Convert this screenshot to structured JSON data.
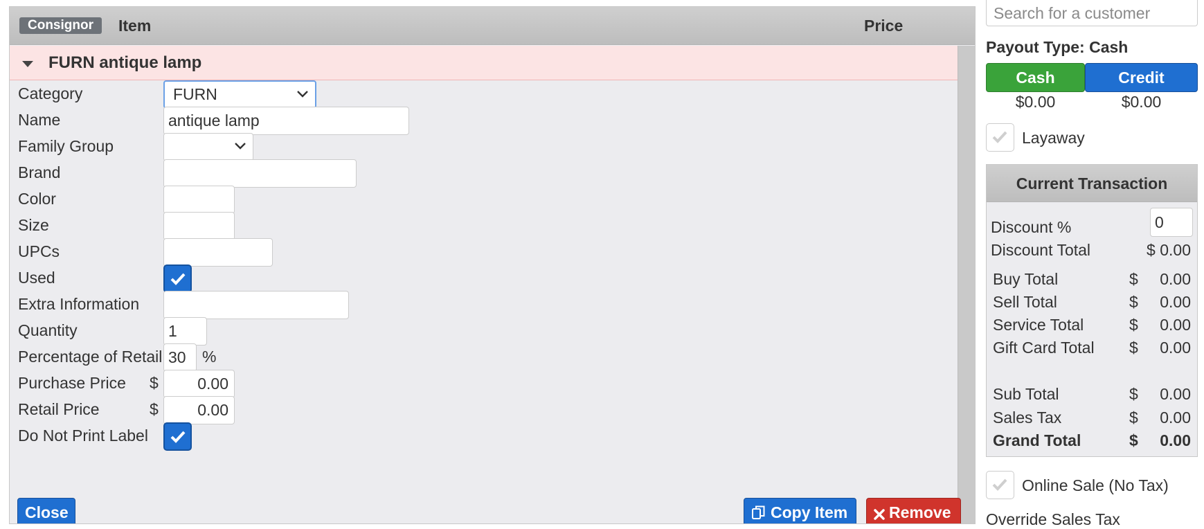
{
  "item_panel": {
    "header": {
      "consignor_badge": "Consignor",
      "item_label": "Item",
      "price_label": "Price"
    },
    "item_title": "FURN antique lamp",
    "fields": {
      "category": {
        "label": "Category",
        "value": "FURN"
      },
      "name": {
        "label": "Name",
        "value": "antique lamp"
      },
      "family_group": {
        "label": "Family Group",
        "value": ""
      },
      "brand": {
        "label": "Brand",
        "value": ""
      },
      "color": {
        "label": "Color",
        "value": ""
      },
      "size": {
        "label": "Size",
        "value": ""
      },
      "upcs": {
        "label": "UPCs",
        "value": ""
      },
      "used": {
        "label": "Used",
        "checked": true
      },
      "extra_information": {
        "label": "Extra Information",
        "value": ""
      },
      "quantity": {
        "label": "Quantity",
        "value": "1"
      },
      "percentage_of_retail": {
        "label": "Percentage of Retail",
        "value": "30",
        "suffix": "%"
      },
      "purchase_price": {
        "label": "Purchase Price",
        "currency": "$",
        "value": "0.00"
      },
      "retail_price": {
        "label": "Retail Price",
        "currency": "$",
        "value": "0.00"
      },
      "do_not_print_label": {
        "label": "Do Not Print Label",
        "checked": true
      }
    },
    "buttons": {
      "close": "Close",
      "copy_item": "Copy Item",
      "remove": "Remove"
    }
  },
  "sidebar": {
    "search_placeholder": "Search for a customer",
    "payout_type": "Payout Type: Cash",
    "payout_buttons": {
      "cash": {
        "label": "Cash",
        "amount": "$0.00"
      },
      "credit": {
        "label": "Credit",
        "amount": "$0.00"
      }
    },
    "layaway": {
      "label": "Layaway",
      "checked": false
    },
    "current_transaction": {
      "title": "Current Transaction",
      "discount_pct_label": "Discount %",
      "discount_pct_value": "0",
      "discount_total_label": "Discount Total",
      "discount_total_value": "$ 0.00",
      "lines": [
        {
          "label": "Buy Total",
          "currency": "$",
          "value": "0.00"
        },
        {
          "label": "Sell Total",
          "currency": "$",
          "value": "0.00"
        },
        {
          "label": "Service Total",
          "currency": "$",
          "value": "0.00"
        },
        {
          "label": "Gift Card Total",
          "currency": "$",
          "value": "0.00"
        }
      ],
      "totals": [
        {
          "label": "Sub Total",
          "currency": "$",
          "value": "0.00"
        },
        {
          "label": "Sales Tax",
          "currency": "$",
          "value": "0.00"
        },
        {
          "label": "Grand Total",
          "currency": "$",
          "value": "0.00"
        }
      ]
    },
    "online_sale": {
      "label": "Online Sale (No Tax)",
      "checked": false
    },
    "override_sales_tax_label": "Override Sales Tax"
  },
  "colors": {
    "primary_blue": "#1f6fd1",
    "success_green": "#3aa33a",
    "danger_red": "#d0342c",
    "item_row_pink": "#fce4e4"
  }
}
